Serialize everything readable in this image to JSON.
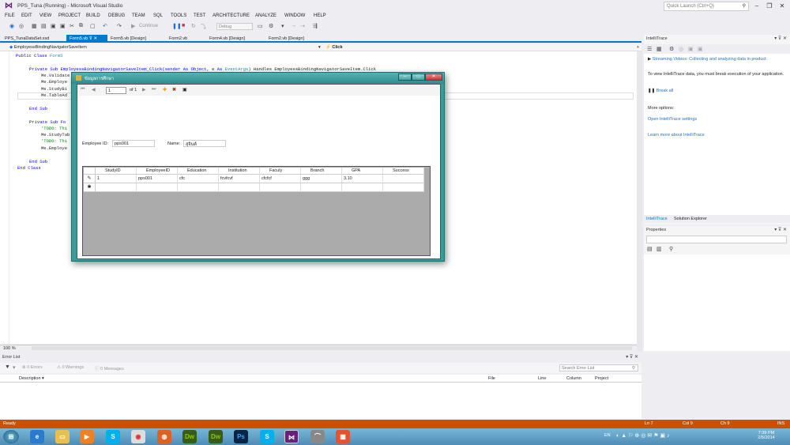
{
  "window": {
    "title": "PPS_Tuna (Running) - Microsoft Visual Studio",
    "quick_launch": "Quick Launch (Ctrl+Q)"
  },
  "menu": [
    "FILE",
    "EDIT",
    "VIEW",
    "PROJECT",
    "BUILD",
    "DEBUG",
    "TEAM",
    "SQL",
    "TOOLS",
    "TEST",
    "ARCHITECTURE",
    "ANALYZE",
    "WINDOW",
    "HELP"
  ],
  "toolbar": {
    "continue_label": "Continue",
    "config": "Debug"
  },
  "tabs": [
    "PPS_TunaDataSet.xsd",
    "Form5.vb",
    "Form5.vb [Design]",
    "Form2.vb",
    "Form4.vb [Design]",
    "Form2.vb [Design]"
  ],
  "navbar": {
    "left": "EmployessBindingNavigatorSaveItem",
    "right": "Click"
  },
  "code": {
    "l1a": "Public Class",
    "l1b": "Form5",
    "l2a": "Private Sub EmployessBindingNavigatorSaveItem_Click(sender",
    "l2b": "As Object",
    "l2c": ", e",
    "l2d": "As",
    "l2e": "EventArgs",
    "l2f": ") Handles EmployessBindingNavigatorSaveItem.Click",
    "l3": "Me.Validate",
    "l4": "Me.Employe",
    "l5": "Me.StudyBi",
    "l6": "Me.TableAd",
    "l7": "End Sub",
    "l8": "Private Sub Fo",
    "l9": "'TODO: Thi",
    "l10": "Me.StudyTab",
    "l11": "'TODO: Thi",
    "l12": "Me.Employe",
    "l13": "End Sub",
    "l14": "End Class"
  },
  "zoom": "100 %",
  "dialog": {
    "title": "ข้อมูลการศึกษา",
    "nav_position": "1",
    "nav_count": "of 1",
    "employee_id_label": "Employee ID:",
    "employee_id": "pps001",
    "name_label": "Name:",
    "name_value": "สุจินต์",
    "columns": [
      "StudyID",
      "EmployeeID",
      "Education",
      "Institution",
      "Faculy",
      "Branch",
      "GPA",
      "Success"
    ],
    "row": [
      "1",
      "pps001",
      "cfc",
      "fcvfcvf",
      "cfcfcf",
      "ggg",
      "3.10",
      ""
    ]
  },
  "intellitrace": {
    "title": "IntelliTrace",
    "streaming": "Streaming Videos: Collecting and analyzing data in product",
    "info": "To view IntelliTrace data, you must break execution of your application.",
    "break_all": "Break all",
    "more_options": "More options:",
    "open_settings": "Open IntelliTrace settings",
    "learn_more": "Learn more about IntelliTrace",
    "tab1": "IntelliTrace",
    "tab2": "Solution Explorer"
  },
  "properties": {
    "title": "Properties"
  },
  "errorlist": {
    "title": "Error List",
    "errors": "0 Errors",
    "warnings": "0 Warnings",
    "messages": "0 Messages",
    "search": "Search Error List",
    "cols": [
      "Description",
      "File",
      "Line",
      "Column",
      "Project"
    ]
  },
  "status": {
    "ready": "Ready",
    "ln": "Ln 7",
    "col": "Col 9",
    "ch": "Ch 9",
    "ins": "INS"
  },
  "taskbar": {
    "lang": "EN",
    "time": "7:39 PM",
    "date": "2/5/2014"
  },
  "colors": {
    "accent": "#007acc",
    "status": "#ca5100",
    "dialog": "#3a9a9a"
  }
}
